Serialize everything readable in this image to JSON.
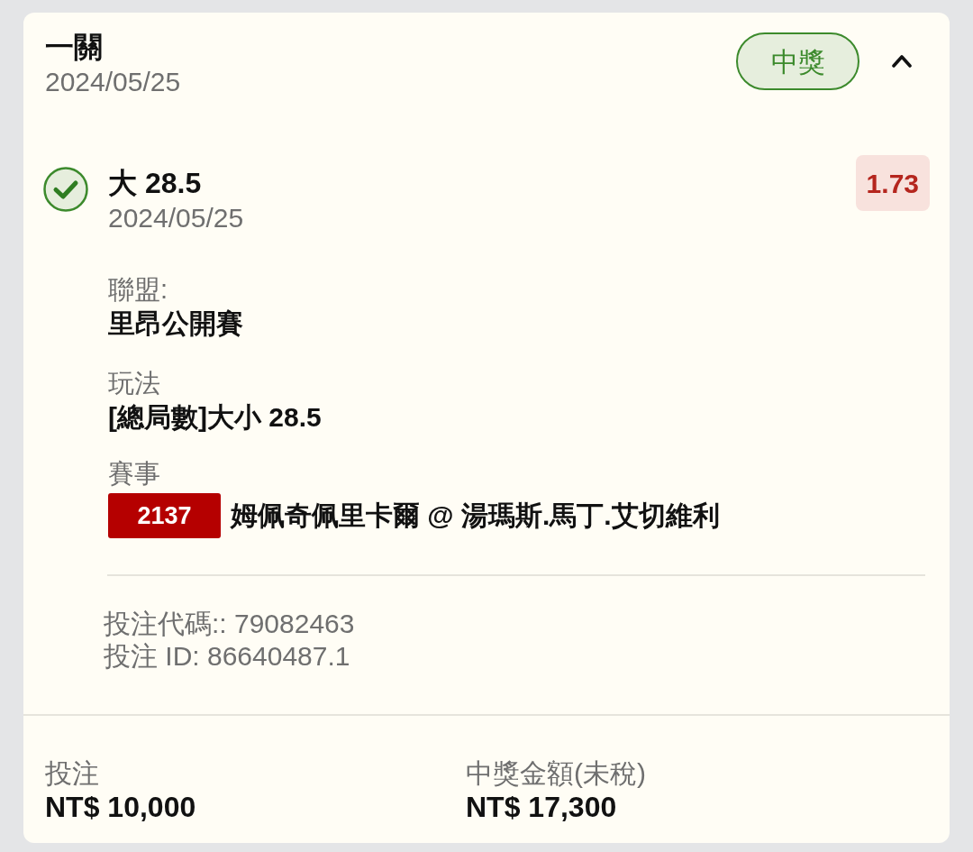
{
  "card": {
    "title": "一關",
    "date": "2024/05/25",
    "status_badge": {
      "label": "中獎",
      "kind": "won"
    },
    "expanded": true
  },
  "selection": {
    "won": true,
    "title": "大 28.5",
    "date": "2024/05/25",
    "odds": "1.73"
  },
  "details": [
    {
      "kind": "text",
      "label": "聯盟:",
      "value": "里昂公開賽"
    },
    {
      "kind": "text",
      "label": "玩法",
      "value": "[總局數]大小 28.5"
    },
    {
      "kind": "event",
      "label": "賽事",
      "event_number": "2137",
      "value": "姆佩奇佩里卡爾 @ 湯瑪斯.馬丁.艾切維利"
    }
  ],
  "codes": [
    "投注代碼:: 79082463",
    "投注 ID: 86640487.1"
  ],
  "summary": [
    {
      "label": "投注",
      "value": "NT$ 10,000"
    },
    {
      "label": "中獎金額(未稅)",
      "value": "NT$ 17,300"
    }
  ]
}
